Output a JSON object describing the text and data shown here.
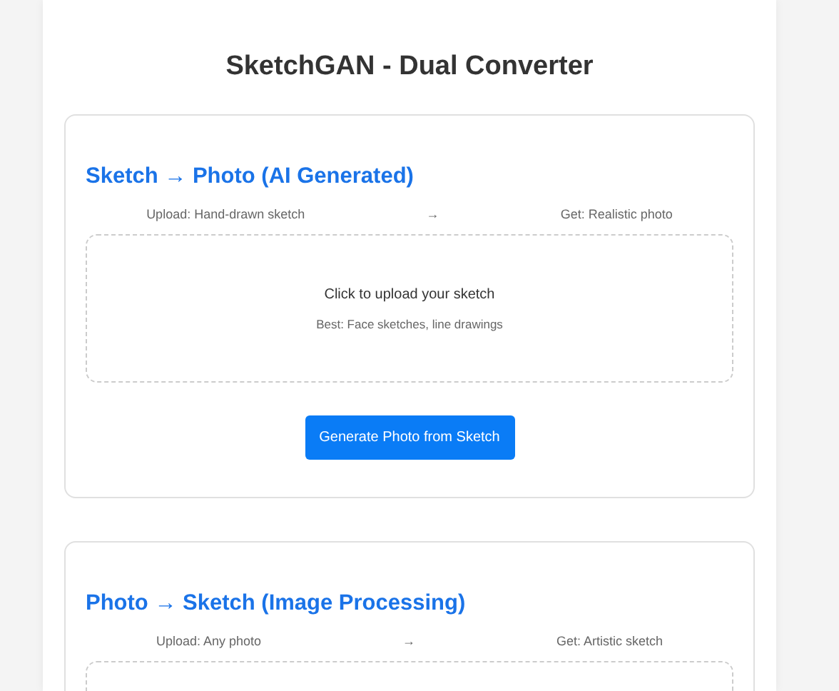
{
  "title": "SketchGAN - Dual Converter",
  "cards": [
    {
      "heading": "Sketch → Photo (AI Generated)",
      "flow": {
        "from": "Upload: Hand-drawn sketch",
        "arrow": "→",
        "to": "Get: Realistic photo"
      },
      "upload": {
        "prompt": "Click to upload your sketch",
        "hint": "Best: Face sketches, line drawings"
      },
      "button": "Generate Photo from Sketch"
    },
    {
      "heading": "Photo → Sketch (Image Processing)",
      "flow": {
        "from": "Upload: Any photo",
        "arrow": "→",
        "to": "Get: Artistic sketch"
      }
    }
  ]
}
